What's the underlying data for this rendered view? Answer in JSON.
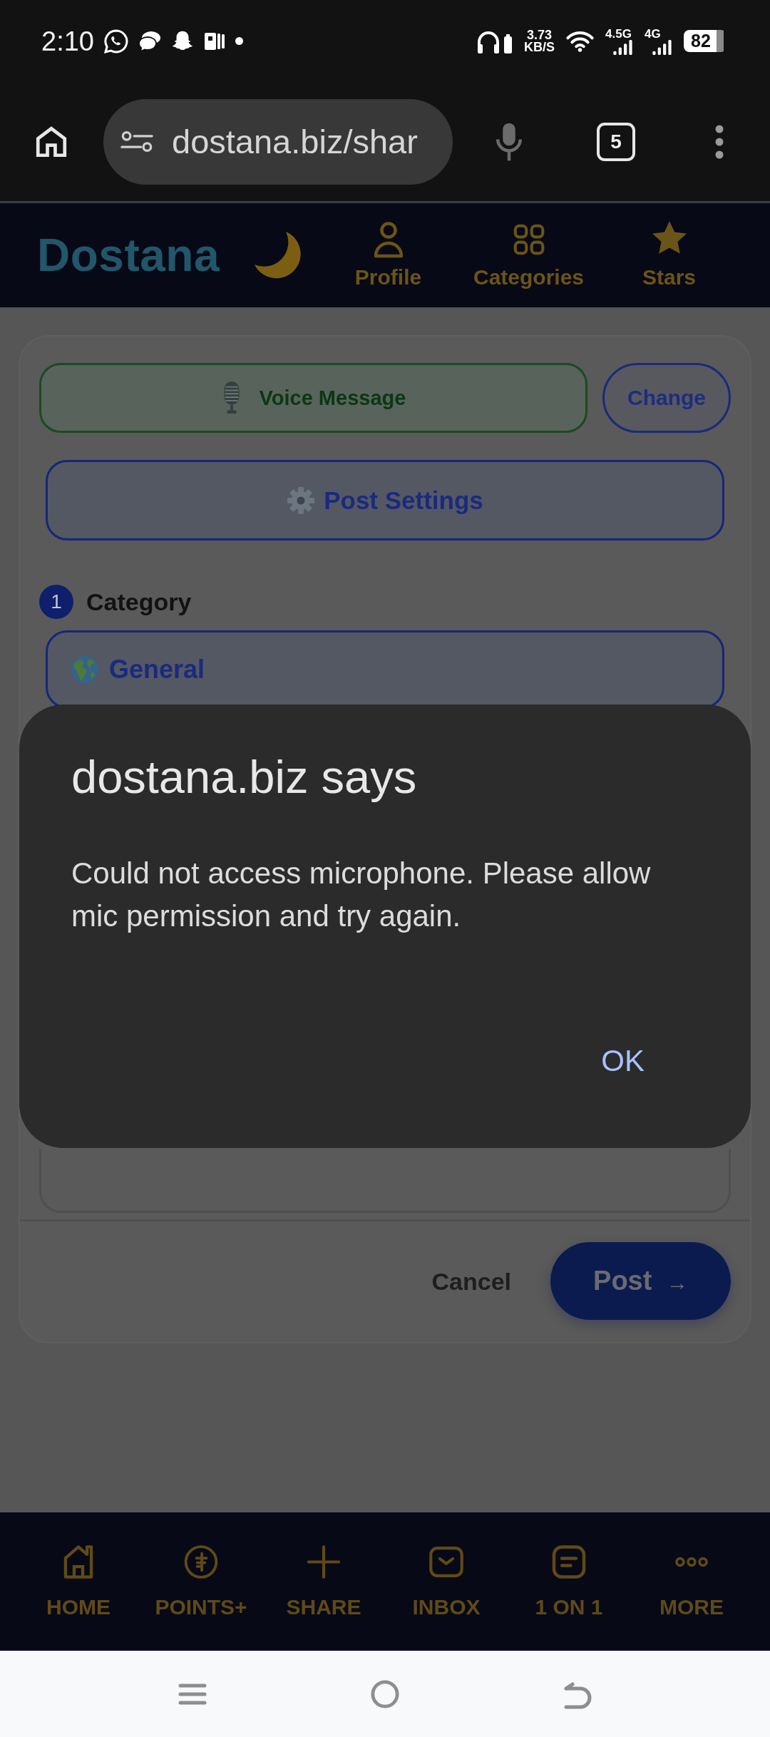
{
  "status_bar": {
    "time": "2:10",
    "speed": {
      "value": "3.73",
      "unit": "KB/S"
    },
    "networks": [
      {
        "label": "4.5G"
      },
      {
        "label": "4G"
      }
    ],
    "battery": "82"
  },
  "browser": {
    "url": "dostana.biz/shar",
    "tab_count": "5"
  },
  "header": {
    "logo": "Dostana",
    "nav": [
      {
        "label": "Profile",
        "kind": "person"
      },
      {
        "label": "Categories",
        "kind": "grid"
      },
      {
        "label": "Stars",
        "kind": "star"
      }
    ]
  },
  "form": {
    "voice_button": "Voice Message",
    "change_button": "Change",
    "settings_button": "Post Settings",
    "category": {
      "step": "1",
      "label": "Category",
      "value": "General"
    },
    "cancel_button": "Cancel",
    "post_button": {
      "label": "Post",
      "arrow": "→"
    }
  },
  "dialog": {
    "title": "dostana.biz says",
    "message": "Could not access microphone. Please allow mic permission and try again.",
    "button": "OK"
  },
  "bottom_nav": [
    {
      "label": "HOME",
      "kind": "home"
    },
    {
      "label": "POINTS+",
      "kind": "coin"
    },
    {
      "label": "SHARE",
      "kind": "plus"
    },
    {
      "label": "INBOX",
      "kind": "inbox"
    },
    {
      "label": "1 ON 1",
      "kind": "chat"
    },
    {
      "label": "MORE",
      "kind": "dots"
    }
  ]
}
